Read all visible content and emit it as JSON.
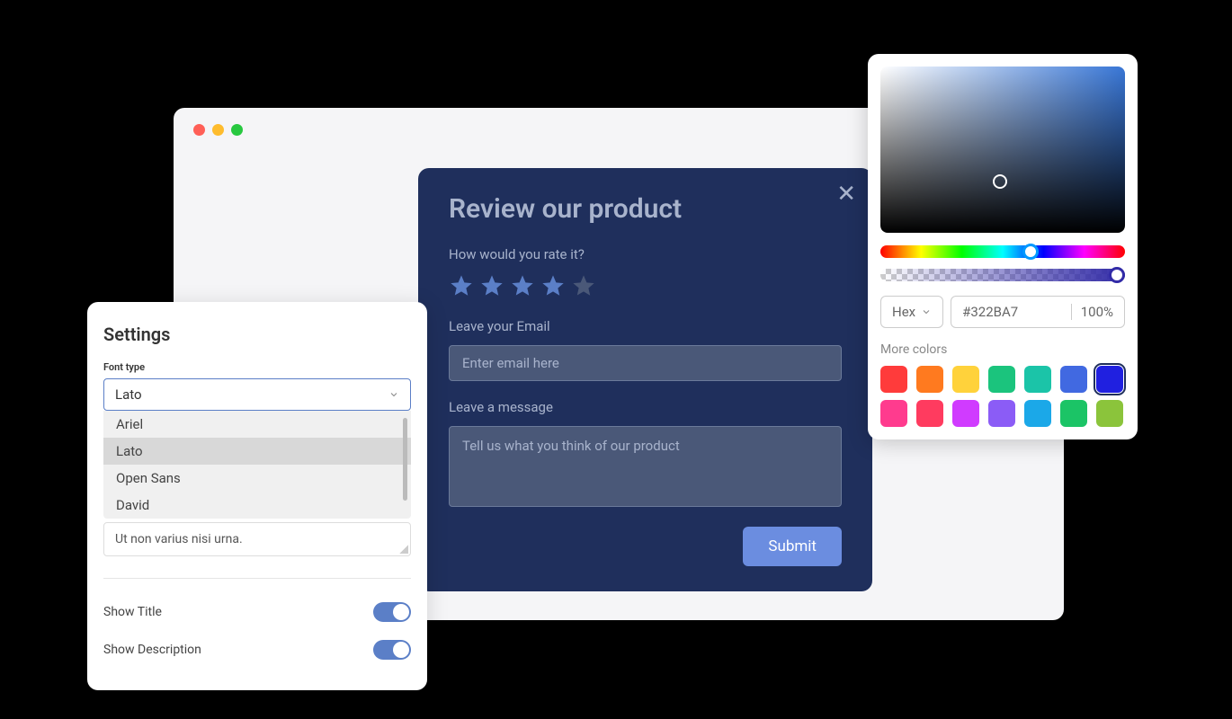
{
  "settings": {
    "title": "Settings",
    "font_type_label": "Font type",
    "selected_font": "Lato",
    "font_options": [
      "Ariel",
      "Lato",
      "Open Sans",
      "David"
    ],
    "textarea_value": "Ut non varius nisi urna.",
    "show_title_label": "Show Title",
    "show_description_label": "Show Description",
    "show_title_on": true,
    "show_description_on": true
  },
  "review": {
    "title": "Review our product",
    "rate_label": "How would you rate it?",
    "rating": 4,
    "email_label": "Leave your Email",
    "email_placeholder": "Enter email here",
    "message_label": "Leave a message",
    "message_placeholder": "Tell us what you think of our product",
    "submit_label": "Submit"
  },
  "color_picker": {
    "format": "Hex",
    "hex_value": "#322BA7",
    "opacity": "100%",
    "more_colors_label": "More colors",
    "swatches": [
      {
        "color": "#ff3b3b",
        "selected": false
      },
      {
        "color": "#ff7a1f",
        "selected": false
      },
      {
        "color": "#ffd23b",
        "selected": false
      },
      {
        "color": "#1bc47d",
        "selected": false
      },
      {
        "color": "#1bc4a8",
        "selected": false
      },
      {
        "color": "#4169e1",
        "selected": false
      },
      {
        "color": "#2020e0",
        "selected": true
      },
      {
        "color": "#ff3b8e",
        "selected": false
      },
      {
        "color": "#ff3b5f",
        "selected": false
      },
      {
        "color": "#d03bff",
        "selected": false
      },
      {
        "color": "#8b5cf6",
        "selected": false
      },
      {
        "color": "#1ba8e8",
        "selected": false
      },
      {
        "color": "#1bc466",
        "selected": false
      },
      {
        "color": "#8bc43b",
        "selected": false
      }
    ]
  }
}
